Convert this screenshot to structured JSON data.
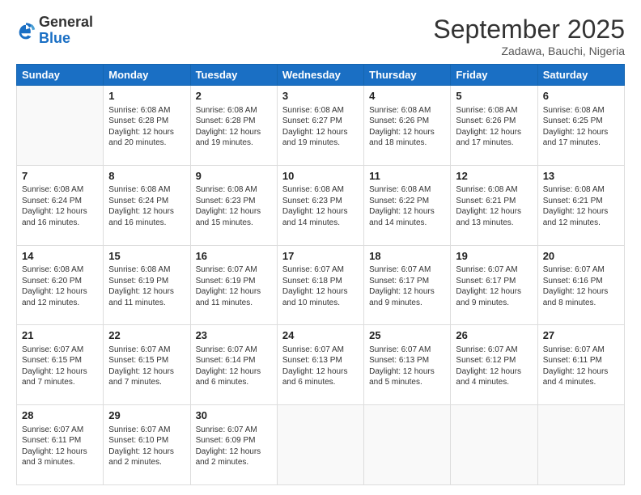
{
  "logo": {
    "general": "General",
    "blue": "Blue"
  },
  "header": {
    "month": "September 2025",
    "location": "Zadawa, Bauchi, Nigeria"
  },
  "days_of_week": [
    "Sunday",
    "Monday",
    "Tuesday",
    "Wednesday",
    "Thursday",
    "Friday",
    "Saturday"
  ],
  "weeks": [
    [
      {
        "day": "",
        "info": ""
      },
      {
        "day": "1",
        "info": "Sunrise: 6:08 AM\nSunset: 6:28 PM\nDaylight: 12 hours\nand 20 minutes."
      },
      {
        "day": "2",
        "info": "Sunrise: 6:08 AM\nSunset: 6:28 PM\nDaylight: 12 hours\nand 19 minutes."
      },
      {
        "day": "3",
        "info": "Sunrise: 6:08 AM\nSunset: 6:27 PM\nDaylight: 12 hours\nand 19 minutes."
      },
      {
        "day": "4",
        "info": "Sunrise: 6:08 AM\nSunset: 6:26 PM\nDaylight: 12 hours\nand 18 minutes."
      },
      {
        "day": "5",
        "info": "Sunrise: 6:08 AM\nSunset: 6:26 PM\nDaylight: 12 hours\nand 17 minutes."
      },
      {
        "day": "6",
        "info": "Sunrise: 6:08 AM\nSunset: 6:25 PM\nDaylight: 12 hours\nand 17 minutes."
      }
    ],
    [
      {
        "day": "7",
        "info": "Sunrise: 6:08 AM\nSunset: 6:24 PM\nDaylight: 12 hours\nand 16 minutes."
      },
      {
        "day": "8",
        "info": "Sunrise: 6:08 AM\nSunset: 6:24 PM\nDaylight: 12 hours\nand 16 minutes."
      },
      {
        "day": "9",
        "info": "Sunrise: 6:08 AM\nSunset: 6:23 PM\nDaylight: 12 hours\nand 15 minutes."
      },
      {
        "day": "10",
        "info": "Sunrise: 6:08 AM\nSunset: 6:23 PM\nDaylight: 12 hours\nand 14 minutes."
      },
      {
        "day": "11",
        "info": "Sunrise: 6:08 AM\nSunset: 6:22 PM\nDaylight: 12 hours\nand 14 minutes."
      },
      {
        "day": "12",
        "info": "Sunrise: 6:08 AM\nSunset: 6:21 PM\nDaylight: 12 hours\nand 13 minutes."
      },
      {
        "day": "13",
        "info": "Sunrise: 6:08 AM\nSunset: 6:21 PM\nDaylight: 12 hours\nand 12 minutes."
      }
    ],
    [
      {
        "day": "14",
        "info": "Sunrise: 6:08 AM\nSunset: 6:20 PM\nDaylight: 12 hours\nand 12 minutes."
      },
      {
        "day": "15",
        "info": "Sunrise: 6:08 AM\nSunset: 6:19 PM\nDaylight: 12 hours\nand 11 minutes."
      },
      {
        "day": "16",
        "info": "Sunrise: 6:07 AM\nSunset: 6:19 PM\nDaylight: 12 hours\nand 11 minutes."
      },
      {
        "day": "17",
        "info": "Sunrise: 6:07 AM\nSunset: 6:18 PM\nDaylight: 12 hours\nand 10 minutes."
      },
      {
        "day": "18",
        "info": "Sunrise: 6:07 AM\nSunset: 6:17 PM\nDaylight: 12 hours\nand 9 minutes."
      },
      {
        "day": "19",
        "info": "Sunrise: 6:07 AM\nSunset: 6:17 PM\nDaylight: 12 hours\nand 9 minutes."
      },
      {
        "day": "20",
        "info": "Sunrise: 6:07 AM\nSunset: 6:16 PM\nDaylight: 12 hours\nand 8 minutes."
      }
    ],
    [
      {
        "day": "21",
        "info": "Sunrise: 6:07 AM\nSunset: 6:15 PM\nDaylight: 12 hours\nand 7 minutes."
      },
      {
        "day": "22",
        "info": "Sunrise: 6:07 AM\nSunset: 6:15 PM\nDaylight: 12 hours\nand 7 minutes."
      },
      {
        "day": "23",
        "info": "Sunrise: 6:07 AM\nSunset: 6:14 PM\nDaylight: 12 hours\nand 6 minutes."
      },
      {
        "day": "24",
        "info": "Sunrise: 6:07 AM\nSunset: 6:13 PM\nDaylight: 12 hours\nand 6 minutes."
      },
      {
        "day": "25",
        "info": "Sunrise: 6:07 AM\nSunset: 6:13 PM\nDaylight: 12 hours\nand 5 minutes."
      },
      {
        "day": "26",
        "info": "Sunrise: 6:07 AM\nSunset: 6:12 PM\nDaylight: 12 hours\nand 4 minutes."
      },
      {
        "day": "27",
        "info": "Sunrise: 6:07 AM\nSunset: 6:11 PM\nDaylight: 12 hours\nand 4 minutes."
      }
    ],
    [
      {
        "day": "28",
        "info": "Sunrise: 6:07 AM\nSunset: 6:11 PM\nDaylight: 12 hours\nand 3 minutes."
      },
      {
        "day": "29",
        "info": "Sunrise: 6:07 AM\nSunset: 6:10 PM\nDaylight: 12 hours\nand 2 minutes."
      },
      {
        "day": "30",
        "info": "Sunrise: 6:07 AM\nSunset: 6:09 PM\nDaylight: 12 hours\nand 2 minutes."
      },
      {
        "day": "",
        "info": ""
      },
      {
        "day": "",
        "info": ""
      },
      {
        "day": "",
        "info": ""
      },
      {
        "day": "",
        "info": ""
      }
    ]
  ]
}
